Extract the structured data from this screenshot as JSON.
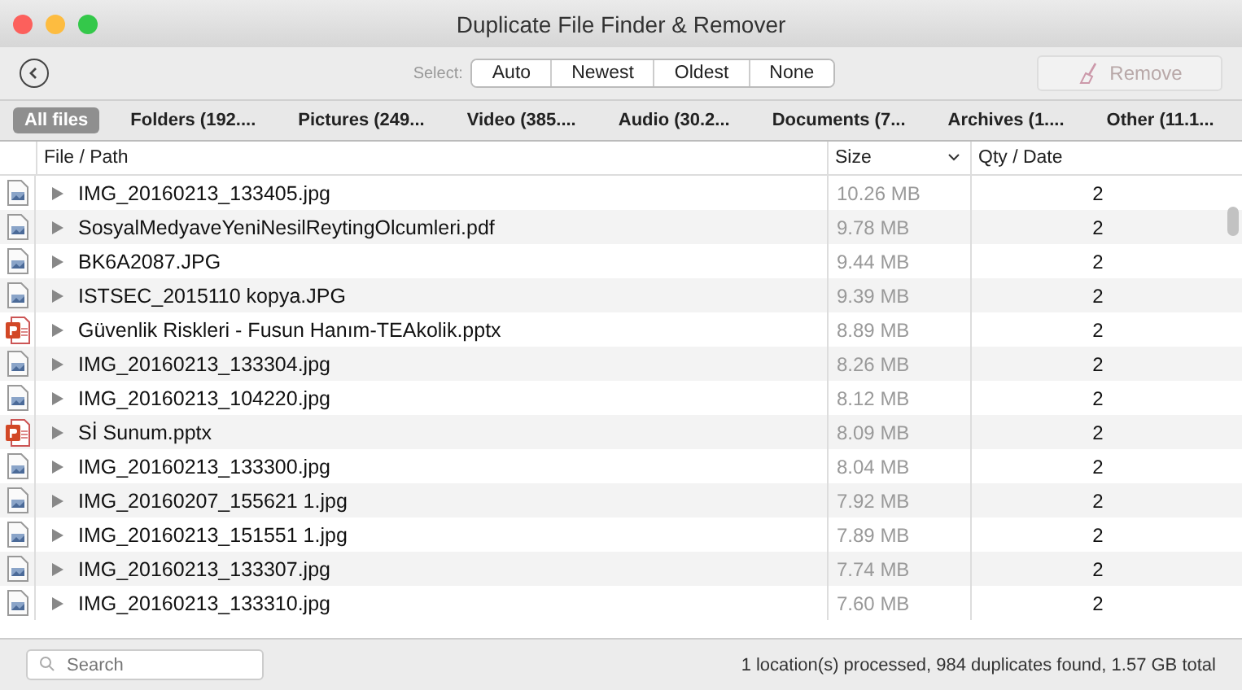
{
  "window": {
    "title": "Duplicate File Finder & Remover"
  },
  "toolbar": {
    "select_label": "Select:",
    "select_options": [
      "Auto",
      "Newest",
      "Oldest",
      "None"
    ],
    "remove": {
      "label": "Remove",
      "disabled": true
    }
  },
  "tabs": [
    {
      "label": "All files",
      "selected": true
    },
    {
      "label": "Folders (192....",
      "selected": false
    },
    {
      "label": "Pictures (249...",
      "selected": false
    },
    {
      "label": "Video (385....",
      "selected": false
    },
    {
      "label": "Audio (30.2...",
      "selected": false
    },
    {
      "label": "Documents (7...",
      "selected": false
    },
    {
      "label": "Archives (1....",
      "selected": false
    },
    {
      "label": "Other (11.1...",
      "selected": false
    }
  ],
  "table": {
    "columns": [
      "File / Path",
      "Size",
      "Qty / Date"
    ],
    "rows": [
      {
        "kind": "image",
        "name": "IMG_20160213_133405.jpg",
        "size": "10.26 MB",
        "qty": "2"
      },
      {
        "kind": "image",
        "name": "SosyalMedyaveYeniNesilReytingOlcumleri.pdf",
        "size": "9.78 MB",
        "qty": "2"
      },
      {
        "kind": "image",
        "name": "BK6A2087.JPG",
        "size": "9.44 MB",
        "qty": "2"
      },
      {
        "kind": "image",
        "name": "ISTSEC_2015110 kopya.JPG",
        "size": "9.39 MB",
        "qty": "2"
      },
      {
        "kind": "presentation",
        "name": "Güvenlik Riskleri - Fusun Hanım-TEAkolik.pptx",
        "size": "8.89 MB",
        "qty": "2"
      },
      {
        "kind": "image",
        "name": "IMG_20160213_133304.jpg",
        "size": "8.26 MB",
        "qty": "2"
      },
      {
        "kind": "image",
        "name": "IMG_20160213_104220.jpg",
        "size": "8.12 MB",
        "qty": "2"
      },
      {
        "kind": "presentation",
        "name": "Sİ Sunum.pptx",
        "size": "8.09 MB",
        "qty": "2"
      },
      {
        "kind": "image",
        "name": "IMG_20160213_133300.jpg",
        "size": "8.04 MB",
        "qty": "2"
      },
      {
        "kind": "image",
        "name": "IMG_20160207_155621 1.jpg",
        "size": "7.92 MB",
        "qty": "2"
      },
      {
        "kind": "image",
        "name": "IMG_20160213_151551 1.jpg",
        "size": "7.89 MB",
        "qty": "2"
      },
      {
        "kind": "image",
        "name": "IMG_20160213_133307.jpg",
        "size": "7.74 MB",
        "qty": "2"
      },
      {
        "kind": "image",
        "name": "IMG_20160213_133310.jpg",
        "size": "7.60 MB",
        "qty": "2"
      }
    ]
  },
  "search": {
    "placeholder": "Search"
  },
  "status_bar": "1 location(s) processed, 984 duplicates found, 1.57 GB total"
}
